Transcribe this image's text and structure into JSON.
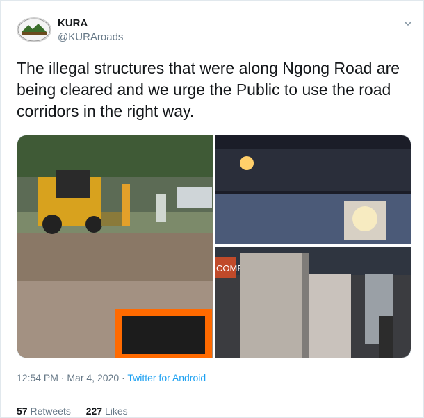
{
  "user": {
    "name": "KURA",
    "handle": "@KURAroads"
  },
  "tweet": {
    "text": "The illegal structures that were along Ngong Road are being cleared and we urge the Public to use the road corridors in the right way.",
    "time": "12:54 PM",
    "date": "Mar 4, 2020",
    "source": "Twitter for Android"
  },
  "media": {
    "sign_text": "COMP"
  },
  "stats": {
    "retweets_count": "57",
    "retweets_label": "Retweets",
    "likes_count": "227",
    "likes_label": "Likes"
  },
  "colors": {
    "link": "#1da1f2",
    "muted": "#657786"
  },
  "icons": [
    "kura-logo-icon",
    "chevron-down-icon"
  ]
}
